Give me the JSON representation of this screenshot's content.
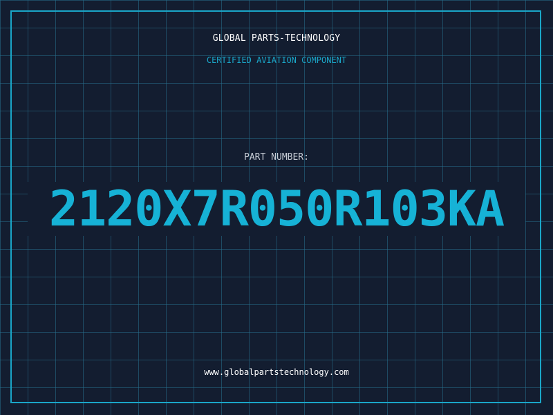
{
  "header": {
    "company": "GLOBAL PARTS-TECHNOLOGY",
    "tagline": "CERTIFIED AVIATION COMPONENT"
  },
  "part": {
    "label": "PART NUMBER:",
    "number": "2120X7R050R103KA"
  },
  "footer": {
    "website": "www.globalpartstechnology.com"
  },
  "colors": {
    "background": "#131d30",
    "grid": "#26708c",
    "accent": "#16b2d6",
    "text": "#ffffff",
    "muted": "#c7cdd6"
  }
}
